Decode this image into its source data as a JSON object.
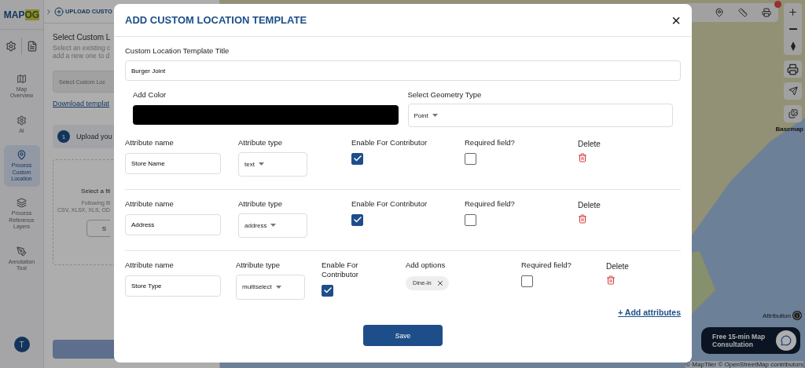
{
  "sidebar": {
    "logo": {
      "text": "MAP",
      "accent": "OG"
    },
    "items": [
      {
        "label": "Map Overview",
        "selected": false
      },
      {
        "label": "AI",
        "selected": false
      },
      {
        "label": "Process Custom Location",
        "selected": true
      },
      {
        "label": "Process Reference Layers",
        "selected": false
      },
      {
        "label": "Annotation Tool",
        "selected": false
      }
    ],
    "avatar": "T"
  },
  "panel": {
    "breadcrumb": "UPLOAD CUSTO",
    "title": "Select Custom L",
    "subtitle_lines": [
      "Select an existing c",
      "add a new one to d"
    ],
    "select": {
      "placeholder": "Select Custom Loc"
    },
    "download_link": "Download templat",
    "step": {
      "number": "1",
      "label": "Upload you"
    },
    "dropzone": {
      "title": "Select a fil",
      "hint_lines": [
        "Following fil",
        "CSV, XLSX, XLS, OD"
      ],
      "button": "S"
    }
  },
  "modal": {
    "title": "ADD CUSTOM LOCATION TEMPLATE",
    "close": "×",
    "title_label": "Custom Location Template Title",
    "title_value": "Burger Joint",
    "color_label": "Add Color",
    "color": "#000000",
    "geometry_label": "Select Geometry Type",
    "geometry_value": "Point",
    "attributes": [
      {
        "name_label": "Attribute name",
        "name": "Store Name",
        "type_label": "Attribute type",
        "type": "text",
        "enable_label": "Enable For Contributor",
        "enable_checked": true,
        "required_label": "Required field?",
        "required_checked": false,
        "delete_label": "Delete"
      },
      {
        "name_label": "Attribute name",
        "name": "Address",
        "type_label": "Attribute type",
        "type": "address",
        "enable_label": "Enable For Contributor",
        "enable_checked": true,
        "required_label": "Required field?",
        "required_checked": false,
        "delete_label": "Delete"
      },
      {
        "name_label": "Attribute name",
        "name": "Store Type",
        "type_label": "Attribute type",
        "type": "multiselect",
        "enable_label": "Enable For Contributor",
        "enable_checked": true,
        "options_label": "Add options",
        "options": [
          "Dine-in"
        ],
        "required_label": "Required field?",
        "required_checked": false,
        "delete_label": "Delete"
      }
    ],
    "add_link": "+ Add attributes",
    "save": "Save"
  },
  "map": {
    "basemap_label": "Basemap",
    "attribution": "Attribution",
    "credits": "© MapTiler © OpenStreetMap contributors",
    "chat": "Free 15-min Map Consultation"
  }
}
